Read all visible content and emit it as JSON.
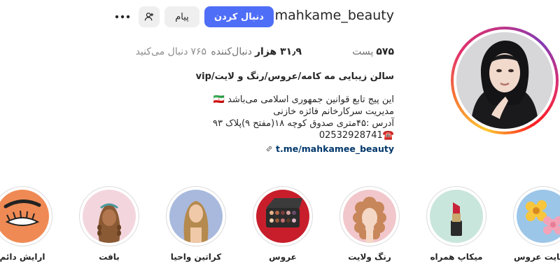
{
  "profile": {
    "username": "mahkame_beauty",
    "follow_label": "دنبال کردن",
    "message_label": "پیام",
    "posts_count": "۵۷۵",
    "posts_label": "پست",
    "followers_count": "۳۱٫۹ هزار",
    "followers_label": "دنبال‌کننده",
    "following_count": "۷۶۵",
    "following_label": "دنبال می‌کنید"
  },
  "bio": {
    "name": "سالن زیبایی مه کامه/عروس/رنگ و لایت/vip",
    "lines": [
      "این پیج تابع قوانین جمهوری اسلامی می‌باشد 🇮🇷",
      "مدیریت سرکارخانم فائزه خازنی",
      "آدرس :۴۵متری صدوق کوچه ۱۸(مفتح ۹)پلاک ۹۳",
      "☎️02532928741"
    ],
    "link": "t.me/mahkamee_beauty"
  },
  "highlights": [
    {
      "label": "رضایت عروس",
      "icon": "flowers"
    },
    {
      "label": "میکاپ همراه",
      "icon": "lipstick"
    },
    {
      "label": "رنگ ولایت",
      "icon": "curly-hair"
    },
    {
      "label": "عروس",
      "icon": "eyeshadow-palette"
    },
    {
      "label": "کراتین واحیا",
      "icon": "long-hair-woman"
    },
    {
      "label": "بافت",
      "icon": "braided-hair"
    },
    {
      "label": "ارایش دائم",
      "icon": "eyelash-eyebrow"
    }
  ],
  "icons": {
    "more": "more-dots-icon",
    "suggest": "add-person-icon",
    "link": "link-icon"
  },
  "colors": {
    "follow_button": "#4f6ef7",
    "link": "#00376b",
    "story_ring": "#e1306c"
  }
}
